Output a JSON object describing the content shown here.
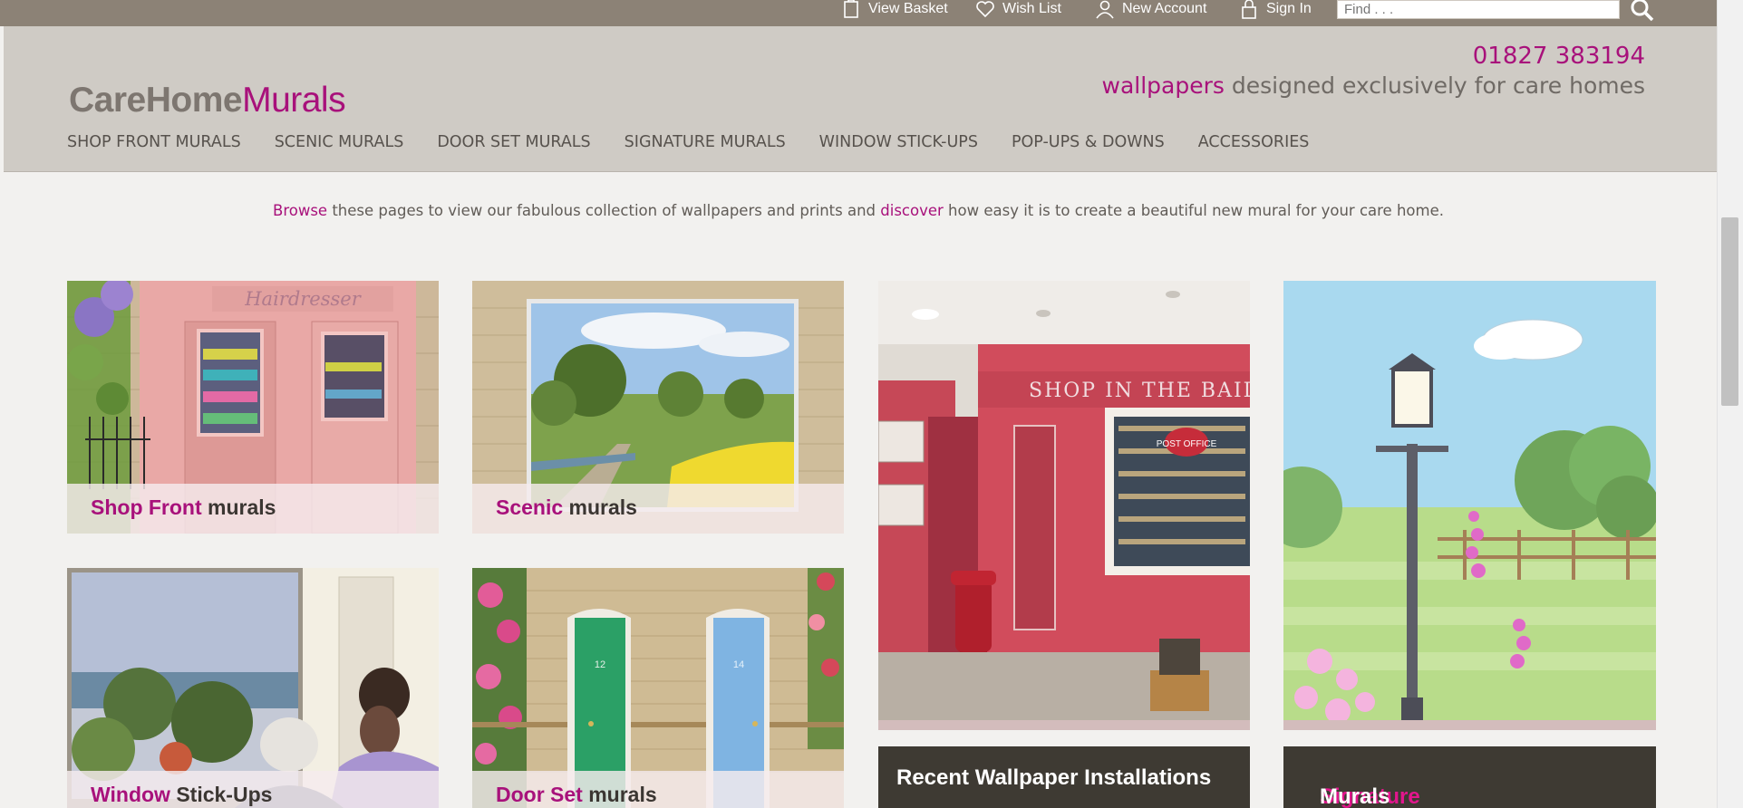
{
  "utility": {
    "view_basket": "View Basket",
    "wish_list": "Wish List",
    "new_account": "New Account",
    "sign_in": "Sign In",
    "find_placeholder": "Find . . ."
  },
  "logo": {
    "part1": "CareHome",
    "part2": "Murals"
  },
  "contact": {
    "phone": "01827 383194",
    "tagline_highlight": "wallpapers",
    "tagline_rest": " designed exclusively for care homes"
  },
  "nav": [
    "SHOP FRONT MURALS",
    "SCENIC MURALS",
    "DOOR SET MURALS",
    "SIGNATURE MURALS",
    "WINDOW STICK-UPS",
    "POP-UPS & DOWNS",
    "ACCESSORIES"
  ],
  "intro": {
    "browse": "Browse",
    "part1": " these pages to view our fabulous collection of wallpapers and prints and ",
    "discover": "discover",
    "part2": " how easy it is to create a beautiful new mural for your care home."
  },
  "tiles": {
    "shop_front": {
      "highlight": "Shop Front",
      "rest": " murals",
      "sign": "Hairdresser"
    },
    "scenic": {
      "highlight": "Scenic",
      "rest": " murals"
    },
    "installations": {
      "label": "Recent Wallpaper Installations",
      "sign": "SHOP IN THE BAIL",
      "post": "POST OFFICE"
    },
    "signature": {
      "highlight": "Signature",
      "rest": " Murals"
    },
    "window": {
      "highlight": "Window",
      "rest": " Stick-Ups"
    },
    "door_set": {
      "highlight": "Door Set",
      "rest": " murals",
      "door1": "12",
      "door2": "14"
    }
  },
  "colors": {
    "brand": "#a8117b",
    "header_bg": "#cfcbc5",
    "topbar_bg": "#8c8276",
    "page_bg": "#f2f1ef"
  }
}
